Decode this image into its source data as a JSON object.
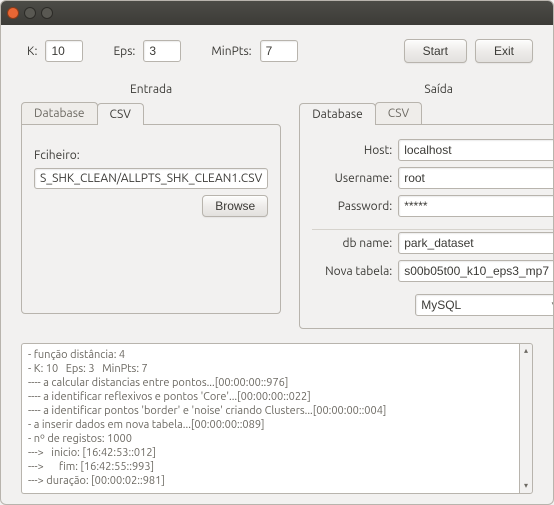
{
  "params": {
    "k_label": "K:",
    "k_value": "10",
    "eps_label": "Eps:",
    "eps_value": "3",
    "minpts_label": "MinPts:",
    "minpts_value": "7",
    "start_label": "Start",
    "exit_label": "Exit"
  },
  "input_panel": {
    "title": "Entrada",
    "tab_db": "Database",
    "tab_csv": "CSV",
    "file_label": "Fciheiro:",
    "file_value": "S_SHK_CLEAN/ALLPTS_SHK_CLEAN1.CSV",
    "browse_label": "Browse"
  },
  "output_panel": {
    "title": "Saída",
    "tab_db": "Database",
    "tab_csv": "CSV",
    "host_label": "Host:",
    "host_value": "localhost",
    "user_label": "Username:",
    "user_value": "root",
    "pass_label": "Password:",
    "pass_value": "*****",
    "dbname_label": "db name:",
    "dbname_value": "park_dataset",
    "newtable_label": "Nova tabela:",
    "newtable_value": "s00b05t00_k10_eps3_mp7",
    "driver_selected": "MySQL"
  },
  "log_lines": [
    "- função distância: 4",
    "- K: 10   Eps: 3   MinPts: 7",
    "---- a calcular distancias entre pontos...[00:00:00::976]",
    "---- a identificar reflexivos e pontos 'Core'...[00:00:00::022]",
    "---- a identificar pontos 'border' e 'noise' criando Clusters...[00:00:00::004]",
    "- a inserir dados em nova tabela...[00:00:00::089]",
    "- nº de registos: 1000",
    "--->   inicio: [16:42:53::012]",
    "--->      fim: [16:42:55::993]",
    "---> duração: [00:00:02::981]"
  ],
  "scroll_icons": {
    "up": "▴",
    "down": "▾"
  }
}
